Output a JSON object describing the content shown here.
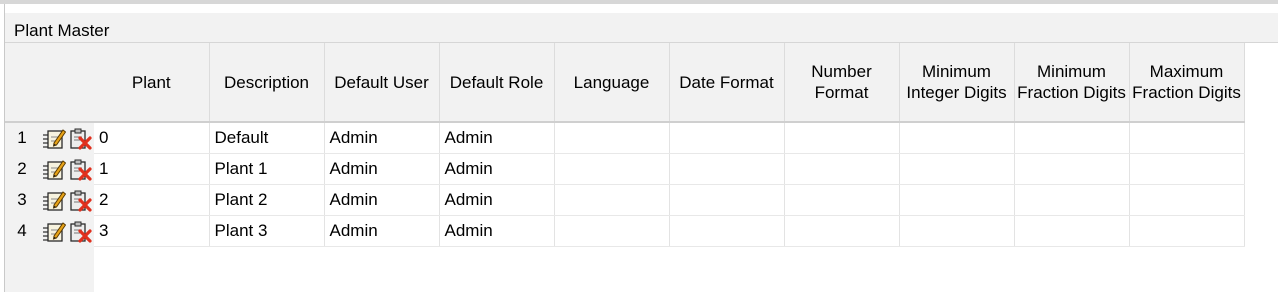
{
  "panel": {
    "title": "Plant Master"
  },
  "grid": {
    "columns": [
      "Plant",
      "Description",
      "Default User",
      "Default Role",
      "Language",
      "Date Format",
      "Number Format",
      "Minimum Integer Digits",
      "Minimum Fraction Digits",
      "Maximum Fraction Digits"
    ],
    "rows": [
      {
        "num": "1",
        "cells": [
          "0",
          "Default",
          "Admin",
          "Admin",
          "",
          "",
          "",
          "",
          "",
          ""
        ]
      },
      {
        "num": "2",
        "cells": [
          "1",
          "Plant 1",
          "Admin",
          "Admin",
          "",
          "",
          "",
          "",
          "",
          ""
        ]
      },
      {
        "num": "3",
        "cells": [
          "2",
          "Plant 2",
          "Admin",
          "Admin",
          "",
          "",
          "",
          "",
          "",
          ""
        ]
      },
      {
        "num": "4",
        "cells": [
          "3",
          "Plant 3",
          "Admin",
          "Admin",
          "",
          "",
          "",
          "",
          "",
          ""
        ]
      }
    ],
    "row_icons": [
      "edit-icon",
      "delete-icon"
    ]
  },
  "colors": {
    "header_bg": "#f2f2f2",
    "delete_accent": "#e0301e",
    "edit_accent": "#e8a317"
  }
}
